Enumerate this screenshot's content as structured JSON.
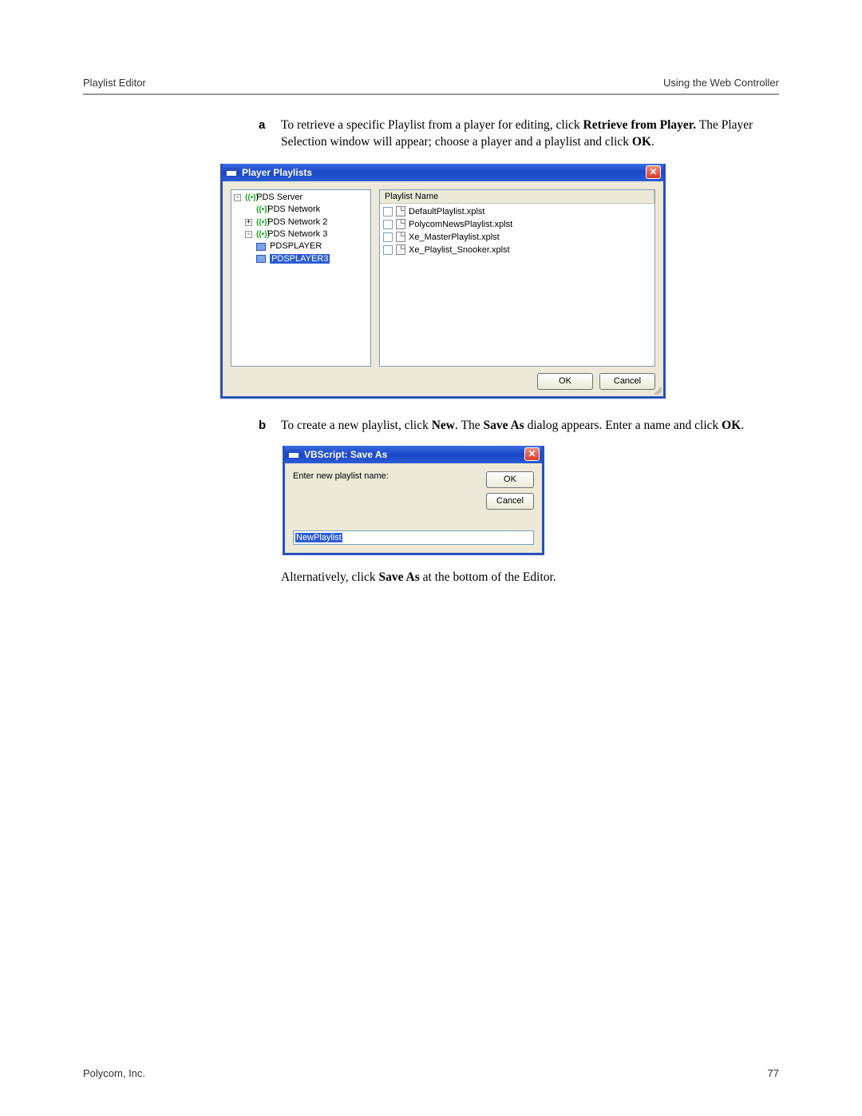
{
  "header": {
    "left": "Playlist Editor",
    "right": "Using the Web Controller"
  },
  "footer": {
    "left": "Polycom, Inc.",
    "right": "77"
  },
  "steps": {
    "a": {
      "letter": "a",
      "text_pre": "To retrieve a specific Playlist from a player for editing, click ",
      "bold1": "Retrieve from Player.",
      "text_mid": " The Player Selection window will appear; choose a player and a playlist and click ",
      "bold2": "OK",
      "text_post": "."
    },
    "b": {
      "letter": "b",
      "text_pre": "To create a new playlist, click ",
      "bold1": "New",
      "text_mid": ". The ",
      "bold2": "Save As",
      "text_mid2": " dialog appears. Enter a name and click ",
      "bold3": "OK",
      "text_post": "."
    },
    "alt": {
      "text_pre": "Alternatively, click ",
      "bold1": "Save As",
      "text_post": " at the bottom of the Editor."
    }
  },
  "dlg1": {
    "title": "Player Playlists",
    "tree": {
      "root": "PDS Server",
      "n1": "PDS Network",
      "n2": "PDS Network 2",
      "n3": "PDS Network 3",
      "p1": "PDSPLAYER",
      "p2": "PDSPLAYER3"
    },
    "list_header": "Playlist Name",
    "files": [
      "DefaultPlaylist.xplst",
      "PolycomNewsPlaylist.xplst",
      "Xe_MasterPlaylist.xplst",
      "Xe_Playlist_Snooker.xplst"
    ],
    "ok": "OK",
    "cancel": "Cancel"
  },
  "dlg2": {
    "title": "VBScript: Save As",
    "prompt": "Enter new playlist name:",
    "ok": "OK",
    "cancel": "Cancel",
    "input_value": "NewPlaylist"
  }
}
